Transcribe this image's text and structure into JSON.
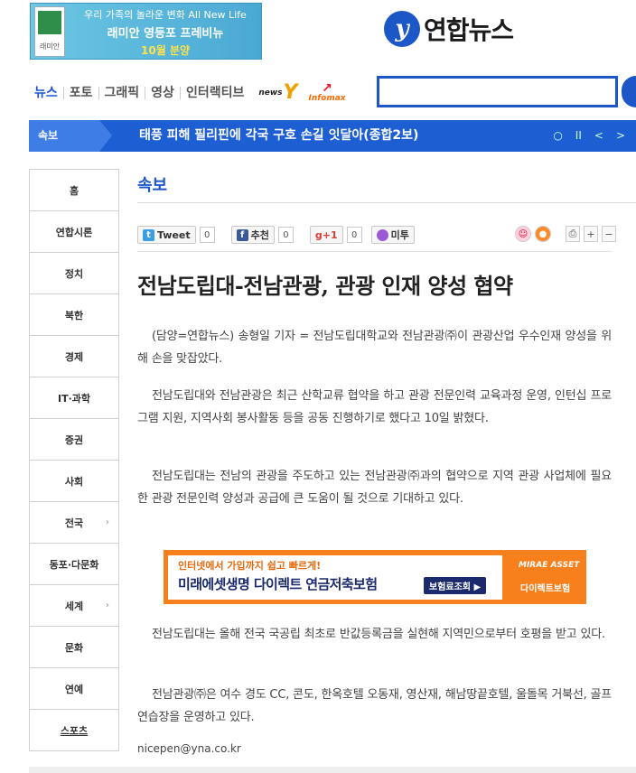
{
  "top_ad": {
    "line1": "우리 가족의 놀라운 변화 All New Life",
    "line2": "래미안 영등포 프레비뉴",
    "line3": "10월 분양",
    "brand": "래미안"
  },
  "site": {
    "logo_mark": "y",
    "name": "연합뉴스"
  },
  "nav": {
    "items": [
      "뉴스",
      "포토",
      "그래픽",
      "영상",
      "인터랙티브"
    ],
    "news_badge": "news",
    "infomax_badge": "Infomax"
  },
  "search": {
    "placeholder": ""
  },
  "breaking": {
    "label": "속보",
    "headline": "태풍 피해 필리핀에 각국 구호 손길 잇달아(종합2보)",
    "controls": [
      "○",
      "II",
      "<",
      ">"
    ]
  },
  "left_menu": [
    {
      "label": "홈"
    },
    {
      "label": "연합시론"
    },
    {
      "label": "정치"
    },
    {
      "label": "북한"
    },
    {
      "label": "경제"
    },
    {
      "label": "IT·과학"
    },
    {
      "label": "증권"
    },
    {
      "label": "사회"
    },
    {
      "label": "전국",
      "arrow": "›"
    },
    {
      "label": "동포·다문화"
    },
    {
      "label": "세계",
      "arrow": "›"
    },
    {
      "label": "문화"
    },
    {
      "label": "연예"
    },
    {
      "label": "스포츠"
    }
  ],
  "section": {
    "title": "속보"
  },
  "share": {
    "tweet_label": "Tweet",
    "tweet_count": "0",
    "fb_label": "추천",
    "fb_count": "0",
    "gplus_label": "g+1",
    "gplus_count": "0",
    "me2_label": "미투"
  },
  "tools": {
    "print": "⎙",
    "plus": "+",
    "minus": "−"
  },
  "article": {
    "title": "전남도립대-전남관광, 관광 인재 양성 협약",
    "p1": "(담양=연합뉴스) 송형일 기자 = 전남도립대학교와 전남관광㈜이 관광산업 우수인재 양성을 위해 손을 맞잡았다.",
    "p2": "전남도립대와 전남관광은 최근 산학교류 협약을 하고 관광 전문인력 교육과정 운영, 인턴십 프로그램 지원, 지역사회 봉사활동 등을 공동 진행하기로 했다고 10일 밝혔다.",
    "p3": "전남도립대는 전남의 관광을 주도하고 있는 전남관광㈜과의 협약으로 지역 관광 사업체에 필요한 관광 전문인력 양성과 공급에 큰 도움이 될 것으로 기대하고 있다.",
    "p4": "전남도립대는 올해 전국 국공립 최초로 반값등록금을 실현해 지역민으로부터 호평을 받고 있다.",
    "p5": "전남관광㈜은 여수 경도 CC, 콘도, 한옥호텔 오동재, 영산재, 해남땅끝호텔, 울돌목 거북선, 골프연습장을 운영하고 있다.",
    "email": "nicepen@yna.co.kr"
  },
  "banner": {
    "line1": "인터넷에서 가입까지 쉽고 빠르게!",
    "line2": "미래에셋생명 다이렉트 연금저축보험",
    "button": "보험료조회 ▶",
    "brand_top": "MIRAE ASSET",
    "brand_bottom": "다이렉트보험"
  },
  "colors": {
    "brand_blue": "#1c57c8",
    "banner_orange": "#f7801d"
  }
}
